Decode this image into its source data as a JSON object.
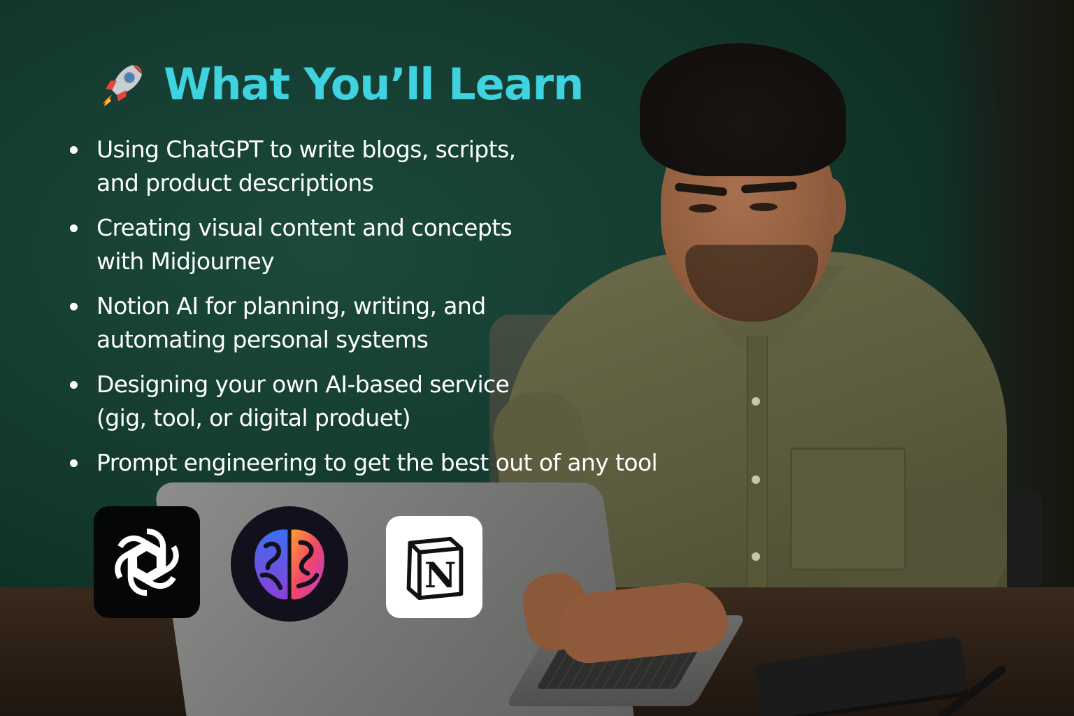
{
  "heading": {
    "icon": "rocket-icon",
    "title": "What You’ll Learn"
  },
  "bullets": [
    {
      "lines": [
        "Using ChatGPT to write blogs, scripts,",
        "and product descriptions"
      ]
    },
    {
      "lines": [
        "Creating visual content and concepts",
        "with Midjourney"
      ]
    },
    {
      "lines": [
        "Notion AI for planning, writing, and",
        "automating personal systems"
      ]
    },
    {
      "lines": [
        "Designing your own AI-based service",
        "(gig, tool, or digital produet)"
      ]
    },
    {
      "lines": [
        "Prompt engineering to get the best out of any tool"
      ]
    }
  ],
  "logos": [
    {
      "icon": "chatgpt-logo-icon"
    },
    {
      "icon": "midjourney-brain-logo-icon"
    },
    {
      "icon": "notion-logo-icon",
      "glyph": "N"
    }
  ],
  "colors": {
    "heading": "#3fd3e0",
    "bullet_text": "#ffffff",
    "background": "#143a2e"
  }
}
